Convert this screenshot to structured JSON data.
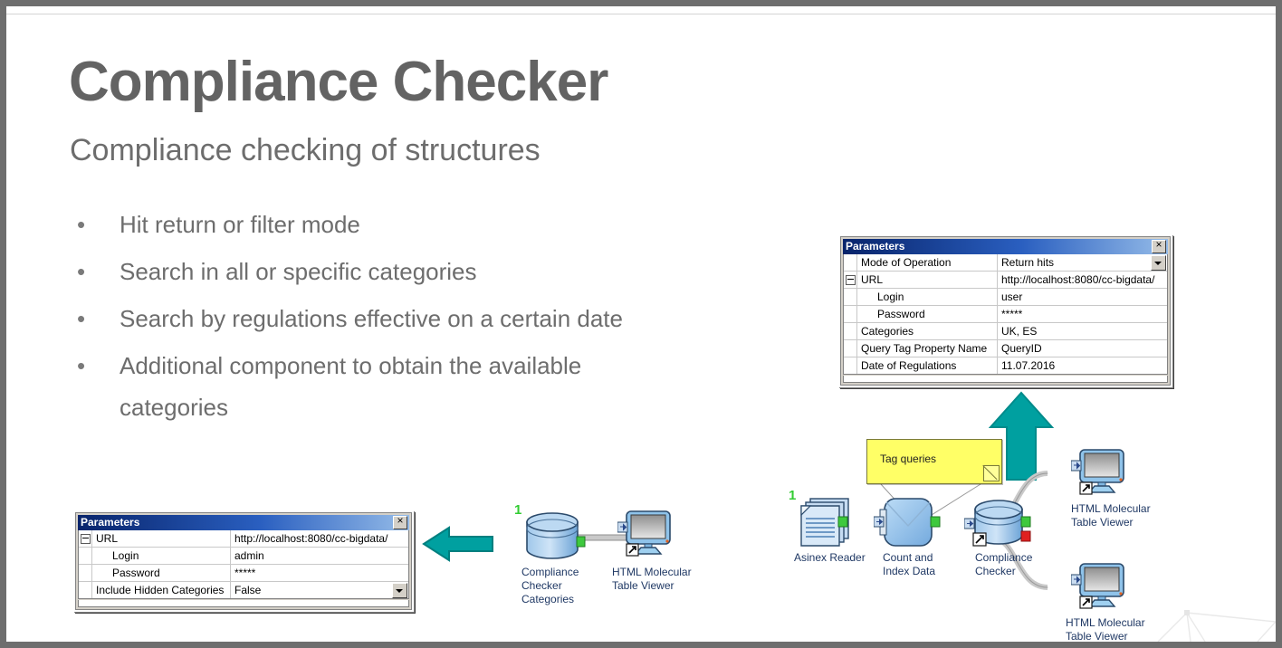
{
  "slide": {
    "title": "Compliance Checker",
    "subtitle": "Compliance checking of structures",
    "bullet_marker": "•",
    "bullets": [
      "Hit return or filter mode",
      "Search in all or specific categories",
      "Search by regulations effective on a certain date",
      "Additional component to obtain the available categories"
    ]
  },
  "colors": {
    "title_gray": "#636363",
    "body_gray": "#6d6d6d",
    "teal_arrow": "#00a0a0",
    "note_yellow": "#ffff66",
    "titlebar_blue": "#08246b",
    "node_blue": "#9dc3e6",
    "port_green": "#33cc33",
    "port_red": "#e02020",
    "caption_navy": "#1f3864",
    "slide_border": "#6e6e6e"
  },
  "dialog_top": {
    "title": "Parameters",
    "close_label": "close-icon",
    "rows": [
      {
        "key": "Mode of Operation",
        "value": "Return hits",
        "indent": false,
        "expander": false,
        "dropdown": true
      },
      {
        "key": "URL",
        "value": "http://localhost:8080/cc-bigdata/",
        "indent": false,
        "expander": true,
        "dropdown": false
      },
      {
        "key": "Login",
        "value": "user",
        "indent": true,
        "expander": false,
        "dropdown": false
      },
      {
        "key": "Password",
        "value": "*****",
        "indent": true,
        "expander": false,
        "dropdown": false
      },
      {
        "key": "Categories",
        "value": "UK, ES",
        "indent": false,
        "expander": false,
        "dropdown": false
      },
      {
        "key": "Query Tag Property Name",
        "value": "QueryID",
        "indent": false,
        "expander": false,
        "dropdown": false
      },
      {
        "key": "Date of Regulations",
        "value": "11.07.2016",
        "indent": false,
        "expander": false,
        "dropdown": false
      }
    ]
  },
  "dialog_bottom": {
    "title": "Parameters",
    "close_label": "close-icon",
    "rows": [
      {
        "key": "URL",
        "value": "http://localhost:8080/cc-bigdata/",
        "indent": false,
        "expander": true,
        "dropdown": false
      },
      {
        "key": "Login",
        "value": "admin",
        "indent": true,
        "expander": false,
        "dropdown": false
      },
      {
        "key": "Password",
        "value": "*****",
        "indent": true,
        "expander": false,
        "dropdown": false
      },
      {
        "key": "Include Hidden Categories",
        "value": "False",
        "indent": false,
        "expander": false,
        "dropdown": true
      }
    ]
  },
  "workflow_small": {
    "port_number": "1",
    "nodes": [
      {
        "name": "Compliance Checker Categories",
        "caption_lines": [
          "Compliance",
          "Checker",
          "Categories"
        ],
        "icon": "database-cylinder-icon"
      },
      {
        "name": "HTML Molecular Table Viewer",
        "caption_lines": [
          "HTML Molecular",
          "Table Viewer"
        ],
        "icon": "monitor-icon"
      }
    ]
  },
  "workflow_large": {
    "port_number": "1",
    "note": "Tag queries",
    "nodes": [
      {
        "name": "Asinex Reader",
        "caption_lines": [
          "Asinex Reader"
        ],
        "icon": "document-stack-icon"
      },
      {
        "name": "Count and Index Data",
        "caption_lines": [
          "Count and",
          "Index Data"
        ],
        "icon": "rounded-node-icon"
      },
      {
        "name": "Compliance Checker",
        "caption_lines": [
          "Compliance",
          "Checker"
        ],
        "icon": "database-cylinder-icon"
      },
      {
        "name": "HTML Molecular Table Viewer",
        "caption_lines": [
          "HTML Molecular",
          "Table Viewer"
        ],
        "icon": "monitor-icon"
      },
      {
        "name": "HTML Molecular Table Viewer",
        "caption_lines": [
          "HTML Molecular",
          "Table Viewer"
        ],
        "icon": "monitor-icon"
      }
    ]
  }
}
